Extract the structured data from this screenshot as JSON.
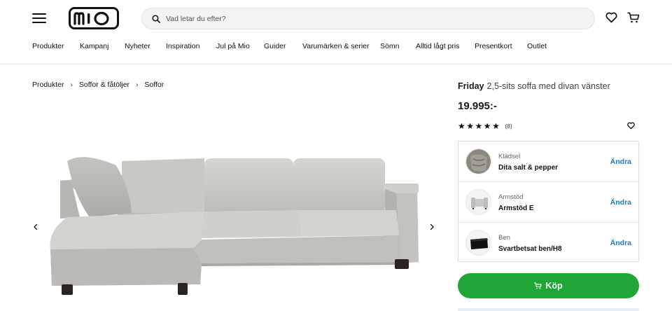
{
  "header": {
    "logo_text": "mio",
    "search_placeholder": "Vad letar du efter?",
    "icons": [
      "menu-icon",
      "search-icon",
      "heart-icon",
      "cart-icon"
    ]
  },
  "nav": {
    "items": [
      "Produkter",
      "Kampanj",
      "Nyheter",
      "Inspiration",
      "Jul på Mio",
      "Guider",
      "Varumärken & serier",
      "Sömn",
      "Alltid lågt pris",
      "Presentkort",
      "Outlet"
    ]
  },
  "breadcrumb": [
    "Produkter",
    "Soffor & fåtöljer",
    "Soffor"
  ],
  "product": {
    "brand": "Friday",
    "name": "2,5-sits soffa med divan vänster",
    "price": "19.995:-",
    "rating": 5,
    "review_count": "(8)"
  },
  "options": [
    {
      "label": "Klädsel",
      "value": "Dita salt & pepper",
      "action": "Ändra"
    },
    {
      "label": "Armstöd",
      "value": "Armstöd E",
      "action": "Ändra"
    },
    {
      "label": "Ben",
      "value": "Svartbetsat ben/H8",
      "action": "Ändra"
    }
  ],
  "buy_label": "Köp",
  "colors": {
    "buy_green": "#20a637",
    "link_blue": "#1a7bb9",
    "sofa_fabric": "#cfcecb"
  }
}
